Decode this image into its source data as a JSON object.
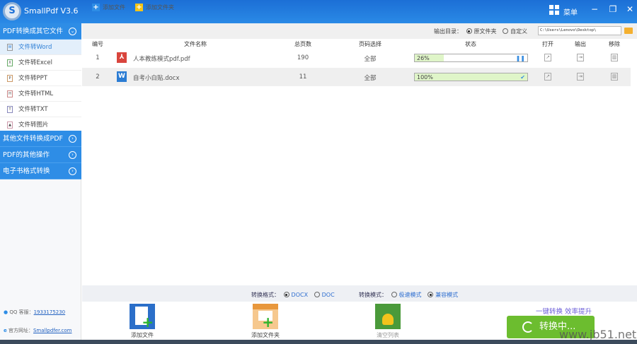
{
  "app": {
    "title": "SmallPdf V3.6",
    "menu_label": "菜单",
    "min": "−",
    "restore": "❐",
    "close": "✕",
    "logo": "S"
  },
  "sidebar": {
    "sections": [
      {
        "label": "PDF转换成其它文件",
        "expanded": true
      },
      {
        "label": "其他文件转换成PDF"
      },
      {
        "label": "PDF的其他操作"
      },
      {
        "label": "电子书格式转换"
      }
    ],
    "items": [
      {
        "label": "文件转Word",
        "icon": "word-icon",
        "active": true
      },
      {
        "label": "文件转Excel",
        "icon": "excel-icon"
      },
      {
        "label": "文件转PPT",
        "icon": "ppt-icon"
      },
      {
        "label": "文件转HTML",
        "icon": "html-icon"
      },
      {
        "label": "文件转TXT",
        "icon": "txt-icon"
      },
      {
        "label": "文件转图片",
        "icon": "image-icon"
      }
    ],
    "qq_label": "QQ 客服：",
    "qq_value": "1933175230",
    "site_label": "官方网址：",
    "site_value": "Smallpdfer.com"
  },
  "toolbar": {
    "add_file": "添加文件",
    "add_folder": "添加文件夹",
    "output_label": "输出目录：",
    "opt_source": "原文件夹",
    "opt_custom": "自定义",
    "output_path": "C:\\Users\\Lenovo\\Desktop\\"
  },
  "table": {
    "headers": [
      "编号",
      "文件名称",
      "总页数",
      "页码选择",
      "状态",
      "打开",
      "输出",
      "移除"
    ],
    "rows": [
      {
        "no": "1",
        "type": "pdf",
        "name": "人本教练模式pdf.pdf",
        "pages": "190",
        "range": "全部",
        "progress": 26,
        "progress_label": "26%",
        "state": "paused-icon"
      },
      {
        "no": "2",
        "type": "word",
        "name": "自考小白贴.docx",
        "pages": "11",
        "range": "全部",
        "progress": 100,
        "progress_label": "100%",
        "state": "check-icon"
      }
    ]
  },
  "options": {
    "format_label": "转换格式：",
    "docx": "DOCX",
    "doc": "DOC",
    "mode_label": "转换模式：",
    "fast": "极速模式",
    "compat": "兼容模式"
  },
  "bottom": {
    "add_file": "添加文件",
    "add_folder": "添加文件夹",
    "clear": "清空列表",
    "slogan": "一键转换  效率提升",
    "convert": "转换中..."
  },
  "watermark": "www.jb51.net",
  "colors": {
    "accent": "#2e8de6",
    "convert": "#6cbd2f",
    "progress": "#dff5c8"
  }
}
